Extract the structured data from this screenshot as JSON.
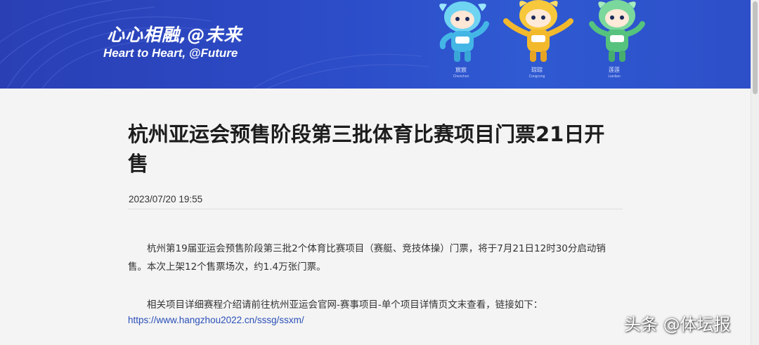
{
  "banner": {
    "slogan_cn": "心心相融,@未来",
    "slogan_en": "Heart to Heart, @Future",
    "mascots": [
      {
        "name": "宸宸",
        "roman": "Chenchen"
      },
      {
        "name": "琮琮",
        "roman": "Congcong"
      },
      {
        "name": "莲莲",
        "roman": "Lianlian"
      }
    ]
  },
  "article": {
    "title": "杭州亚运会预售阶段第三批体育比赛项目门票21日开售",
    "date": "2023/07/20 19:55",
    "paragraph1": "杭州第19届亚运会预售阶段第三批2个体育比赛项目（赛艇、竞技体操）门票，将于7月21日12时30分启动销售。本次上架12个售票场次，约1.4万张门票。",
    "paragraph2": "相关项目详细赛程介绍请前往杭州亚运会官网-赛事项目-单个项目详情页文末查看，链接如下：",
    "link": "https://www.hangzhou2022.cn/sssg/ssxm/"
  },
  "watermark": "头条 @体坛报",
  "colors": {
    "banner": "#2c4cc8",
    "link": "#2a4fb8",
    "page_bg": "#f4f4f4"
  }
}
